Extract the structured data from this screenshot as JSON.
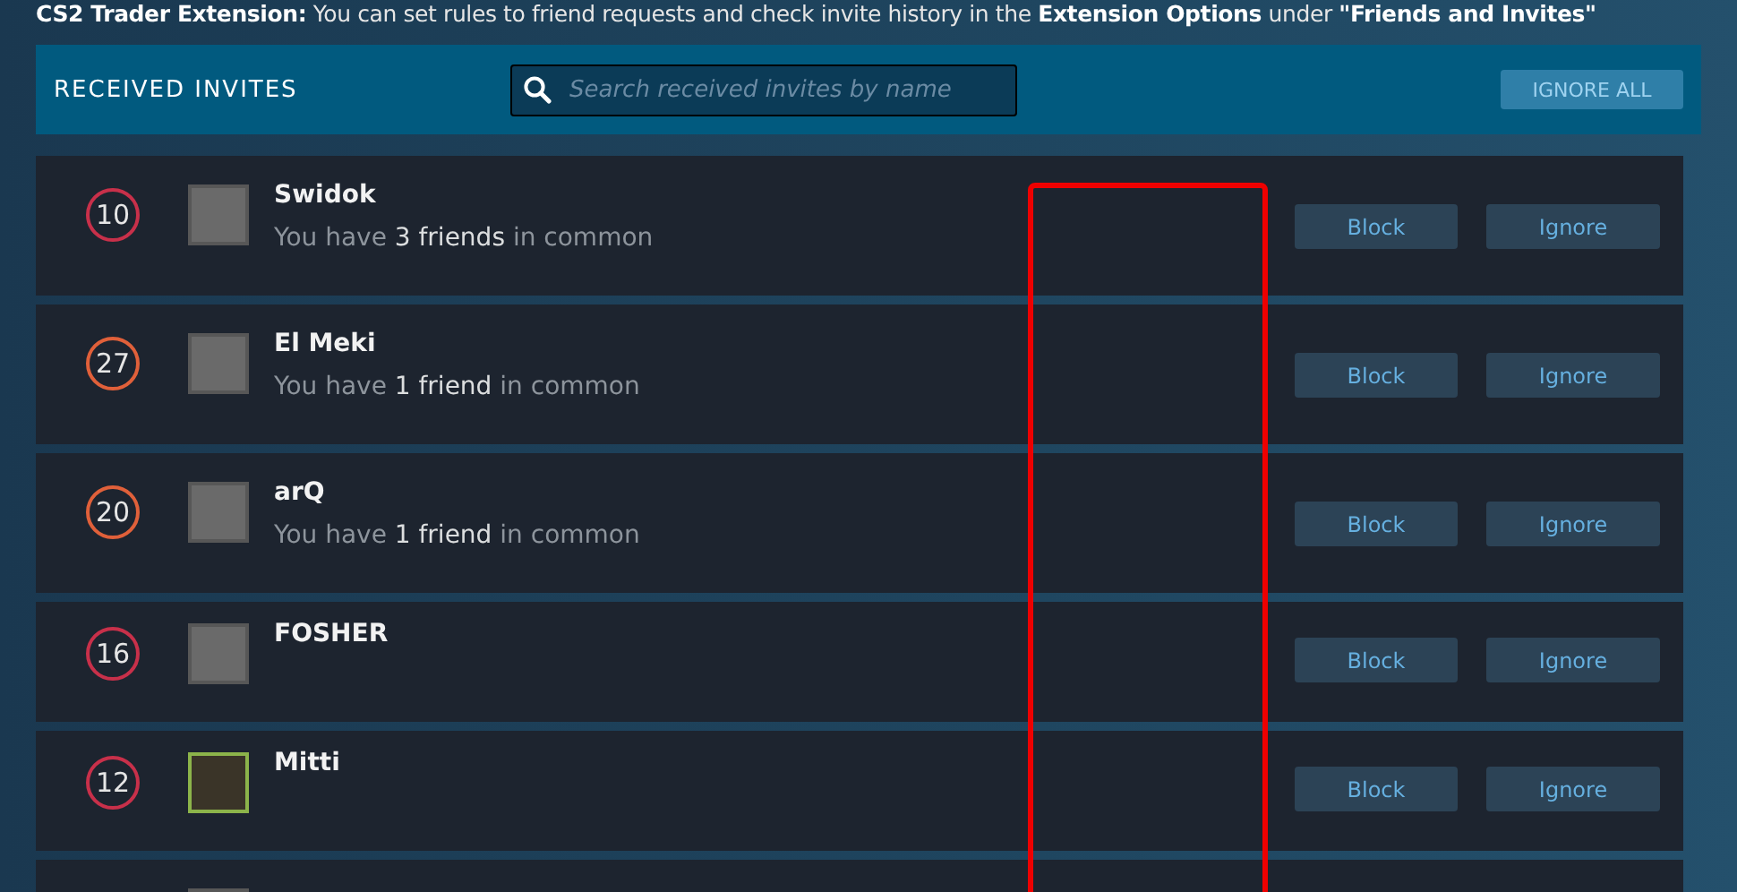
{
  "notice": "**CS2 Trader Extension:** You can set rules to friend requests and check invite history in the **Extension Options** under **\"Friends and Invites\"**",
  "header": {
    "title": "RECEIVED INVITES",
    "search": {
      "placeholder": "Search received invites by name"
    },
    "ignore_all": "IGNORE ALL"
  },
  "invites": [
    {
      "level": "10",
      "color": "#c8304a",
      "name": "Swidok",
      "in_game": false,
      "common": "You have **3 friends** in common",
      "block": "Block",
      "ignore": "Ignore"
    },
    {
      "level": "27",
      "color": "#e0603a",
      "name": "El Meki",
      "in_game": false,
      "common": "You have **1 friend** in common",
      "block": "Block",
      "ignore": "Ignore"
    },
    {
      "level": "20",
      "color": "#e0603a",
      "name": "arQ",
      "in_game": false,
      "common": "You have **1 friend** in common",
      "block": "Block",
      "ignore": "Ignore"
    },
    {
      "level": "16",
      "color": "#c8304a",
      "name": "FOSHER",
      "in_game": false,
      "block": "Block",
      "ignore": "Ignore"
    },
    {
      "level": "12",
      "color": "#c8304a",
      "name": "Mitti",
      "in_game": true,
      "block": "Block",
      "ignore": "Ignore"
    }
  ]
}
